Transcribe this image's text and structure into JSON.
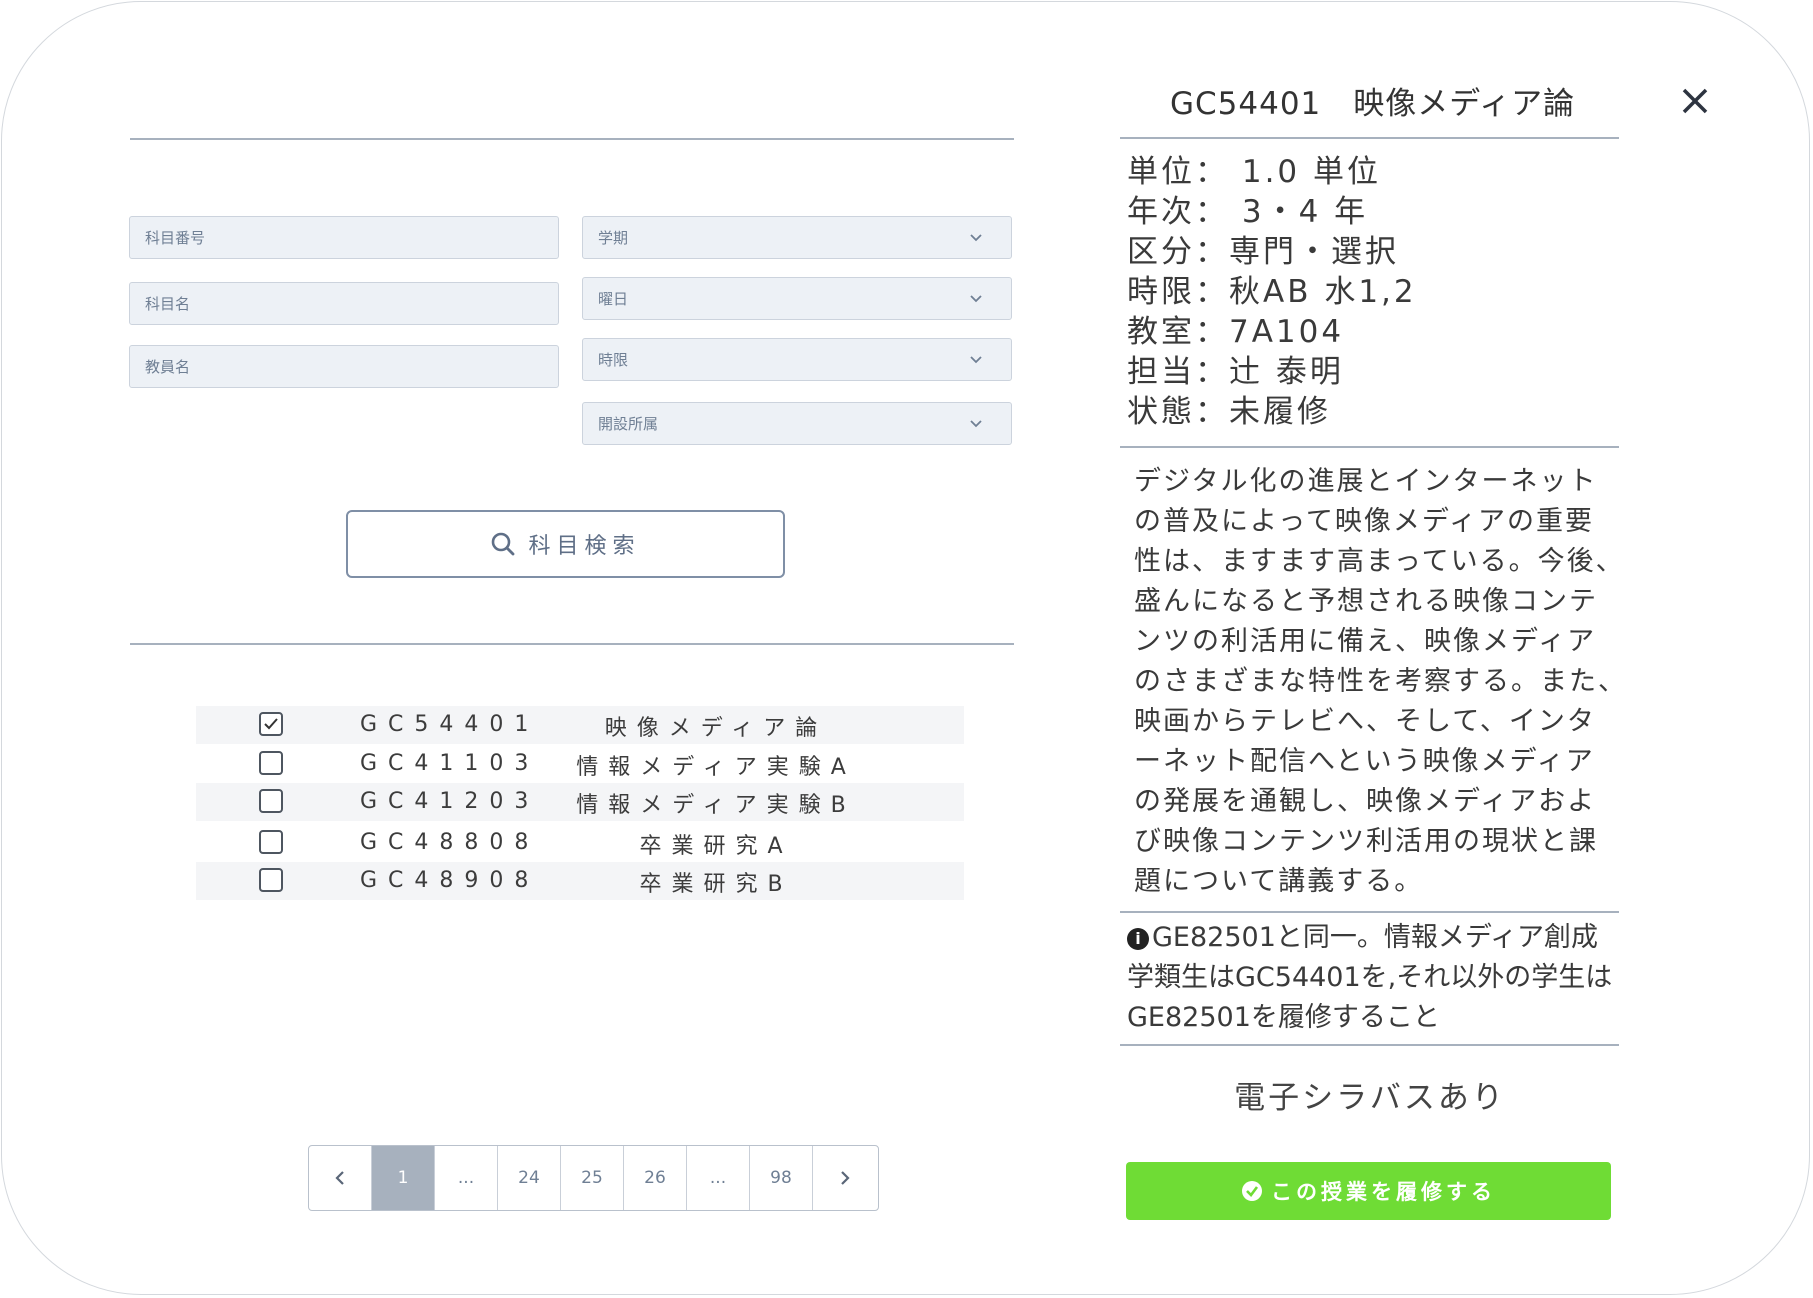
{
  "search": {
    "course_number_placeholder": "科目番号",
    "course_name_placeholder": "科目名",
    "instructor_placeholder": "教員名",
    "term_select": "学期",
    "day_select": "曜日",
    "period_select": "時限",
    "department_select": "開設所属",
    "search_button": "科目検索"
  },
  "results": [
    {
      "code": "GC54401",
      "name": "映像メディア論",
      "checked": true
    },
    {
      "code": "GC41103",
      "name": "情報メディア実験A",
      "checked": false
    },
    {
      "code": "GC41203",
      "name": "情報メディア実験B",
      "checked": false
    },
    {
      "code": "GC48808",
      "name": "卒業研究A",
      "checked": false
    },
    {
      "code": "GC48908",
      "name": "卒業研究B",
      "checked": false
    }
  ],
  "pagination": {
    "prev": "‹",
    "pages": [
      "1",
      "...",
      "24",
      "25",
      "26",
      "...",
      "98"
    ],
    "next": "›",
    "active_page": "1"
  },
  "detail": {
    "title": "GC54401　映像メディア論",
    "info": [
      "単位： 1.0 単位",
      "年次： 3・4 年",
      "区分：専門・選択",
      "時限：秋AB 水1,2",
      "教室：7A104",
      "担当：辻 泰明",
      "状態：未履修"
    ],
    "description_lines": [
      "デジタル化の進展とインターネット",
      "の普及によって映像メディアの重要",
      "性は、ますます高まっている。今後、",
      "盛んになると予想される映像コンテ",
      "ンツの利活用に備え、映像メディア",
      "のさまざまな特性を考察する。また、",
      "映画からテレビへ、そして、インタ",
      "ーネット配信へという映像メディア",
      "の発展を通観し、映像メディアおよ",
      "び映像コンテンツ利活用の現状と課",
      "題について講義する。"
    ],
    "note_lines": [
      "GE82501と同一。情報メディア創成",
      "学類生はGC54401を,それ以外の学生は",
      "GE82501を履修すること"
    ],
    "e_syllabus": "電子シラバスあり",
    "enroll_button": "この授業を履修する"
  },
  "colors": {
    "accent_green": "#6fdc35",
    "divider": "#a7b1be",
    "field_bg": "#edf1f6",
    "active_page_bg": "#a7b1be"
  },
  "icons": {
    "close": "close-icon",
    "search": "search-icon",
    "chevron": "chevron-down-icon",
    "info": "info-icon",
    "check_circle": "check-circle-icon"
  }
}
